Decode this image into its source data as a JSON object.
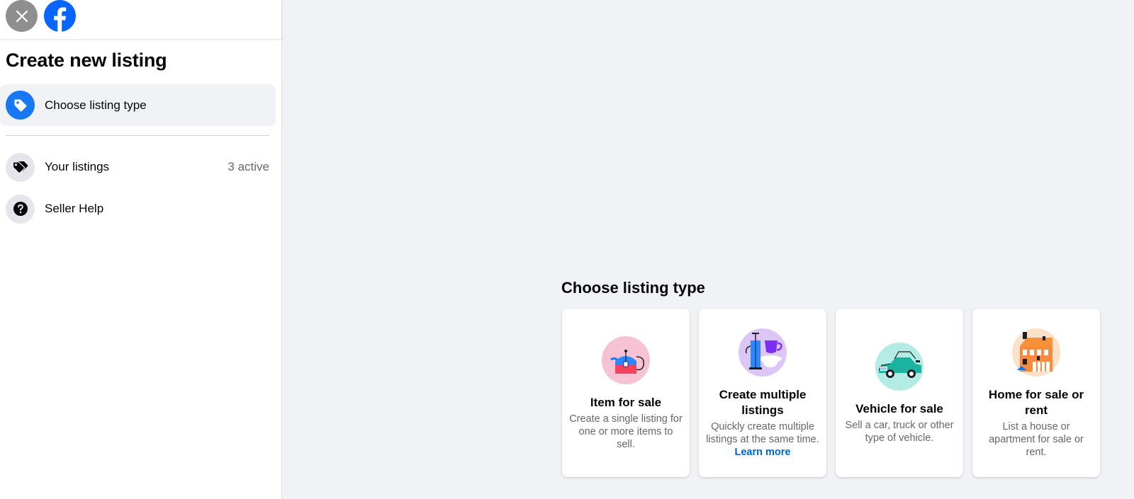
{
  "sidebar": {
    "title": "Create new listing",
    "active_item": {
      "label": "Choose listing type",
      "icon": "tag-icon"
    },
    "items": [
      {
        "label": "Your listings",
        "meta": "3 active",
        "icon": "tags-icon"
      },
      {
        "label": "Seller Help",
        "meta": "",
        "icon": "help-icon"
      }
    ]
  },
  "main": {
    "title": "Choose listing type",
    "cards": [
      {
        "title": "Item for sale",
        "description": "Create a single listing for one or more items to sell.",
        "icon": "teapot-icon"
      },
      {
        "title": "Create multiple listings",
        "description": "Quickly create multiple listings at the same time.",
        "link": "Learn more",
        "icon": "coffee-press-icon"
      },
      {
        "title": "Vehicle for sale",
        "description": "Sell a car, truck or other type of vehicle.",
        "icon": "car-icon"
      },
      {
        "title": "Home for sale or rent",
        "description": "List a house or apartment for sale or rent.",
        "icon": "house-icon"
      }
    ]
  },
  "colors": {
    "brand_blue": "#1877f2",
    "page_bg": "#f0f2f5",
    "link_blue": "#0064d1"
  }
}
